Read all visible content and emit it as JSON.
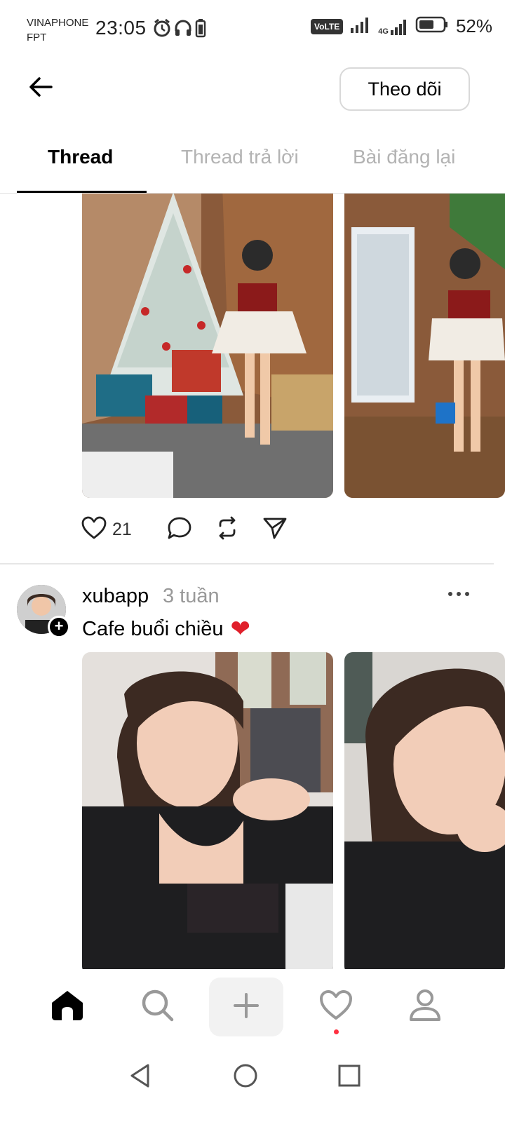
{
  "status_bar": {
    "carrier_line1": "VINAPHONE",
    "carrier_line2": "FPT",
    "time": "23:05",
    "network": "4G",
    "volte": "VoLTE",
    "battery": "52%"
  },
  "header": {
    "follow_label": "Theo dõi"
  },
  "tabs": [
    {
      "label": "Thread",
      "active": true
    },
    {
      "label": "Thread trả lời",
      "active": false
    },
    {
      "label": "Bài đăng lại",
      "active": false
    }
  ],
  "post1": {
    "like_count": "21"
  },
  "post2": {
    "username": "xubapp",
    "time_ago": "3 tuần",
    "caption": "Cafe buổi chiều",
    "caption_emoji": "❤"
  },
  "bottom_nav": {
    "items": [
      "home-icon",
      "search-icon",
      "plus-icon",
      "heart-icon",
      "profile-icon"
    ],
    "active": "home-icon"
  },
  "colors": {
    "notification_dot": "#ff3040",
    "heart_emoji": "#e0202b",
    "inactive_tab": "#b3b3b3"
  }
}
